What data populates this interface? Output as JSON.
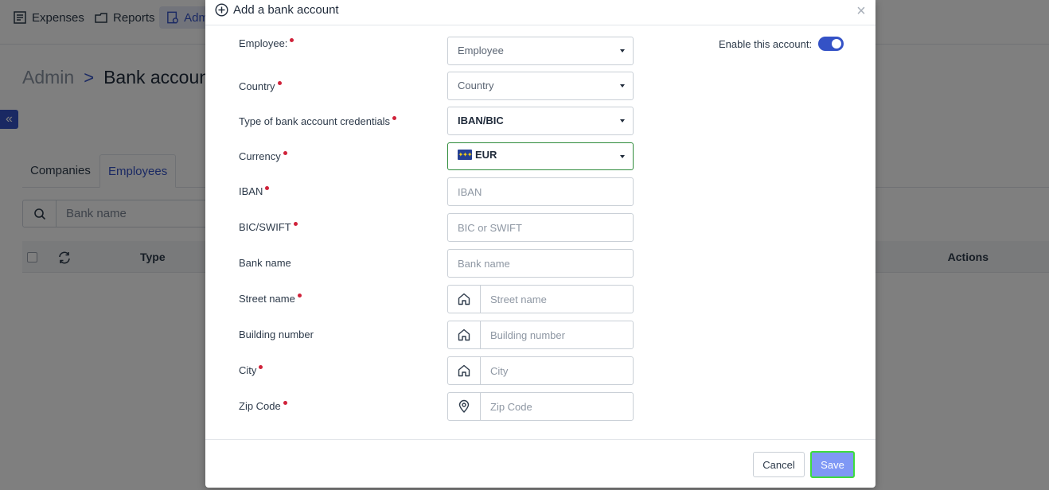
{
  "app": {
    "nav": [
      {
        "label": "Expenses",
        "icon": "expenses-icon"
      },
      {
        "label": "Reports",
        "icon": "reports-icon"
      },
      {
        "label": "Adm",
        "icon": "admin-icon",
        "active": true
      }
    ],
    "breadcrumb": {
      "root": "Admin",
      "separator": ">",
      "current": "Bank accoun"
    },
    "collapse_label": "«",
    "tabs": [
      {
        "label": "Companies",
        "active": false
      },
      {
        "label": "Employees",
        "active": true
      }
    ],
    "search": {
      "placeholder": "Bank name"
    },
    "table": {
      "columns": {
        "type": "Type",
        "actions": "Actions"
      }
    }
  },
  "modal": {
    "title": "Add a bank account",
    "close_label": "×",
    "enable": {
      "label": "Enable this account:",
      "enabled": true
    },
    "fields": {
      "employee": {
        "label": "Employee:",
        "value": "Employee",
        "required": true
      },
      "country": {
        "label": "Country",
        "value": "Country",
        "required": true
      },
      "credentials": {
        "label": "Type of bank account credentials",
        "value": "IBAN/BIC",
        "required": true
      },
      "currency": {
        "label": "Currency",
        "value": "EUR",
        "required": true,
        "flag": "eu-flag-icon"
      },
      "iban": {
        "label": "IBAN",
        "placeholder": "IBAN",
        "required": true
      },
      "bic": {
        "label": "BIC/SWIFT",
        "placeholder": "BIC or SWIFT",
        "required": true
      },
      "bank_name": {
        "label": "Bank name",
        "placeholder": "Bank name",
        "required": false
      },
      "street": {
        "label": "Street name",
        "placeholder": "Street name",
        "required": true,
        "icon": "home-icon"
      },
      "building": {
        "label": "Building number",
        "placeholder": "Building number",
        "required": false,
        "icon": "home-icon"
      },
      "city": {
        "label": "City",
        "placeholder": "City",
        "required": true,
        "icon": "home-icon"
      },
      "zip": {
        "label": "Zip Code",
        "placeholder": "Zip Code",
        "required": true,
        "icon": "location-pin-icon"
      }
    },
    "footer": {
      "cancel": "Cancel",
      "save": "Save"
    }
  },
  "colors": {
    "accent": "#3452c6",
    "required": "#d0223a",
    "annotation_arrow": "#3ddc3d",
    "save_button": "#7f98f5"
  }
}
